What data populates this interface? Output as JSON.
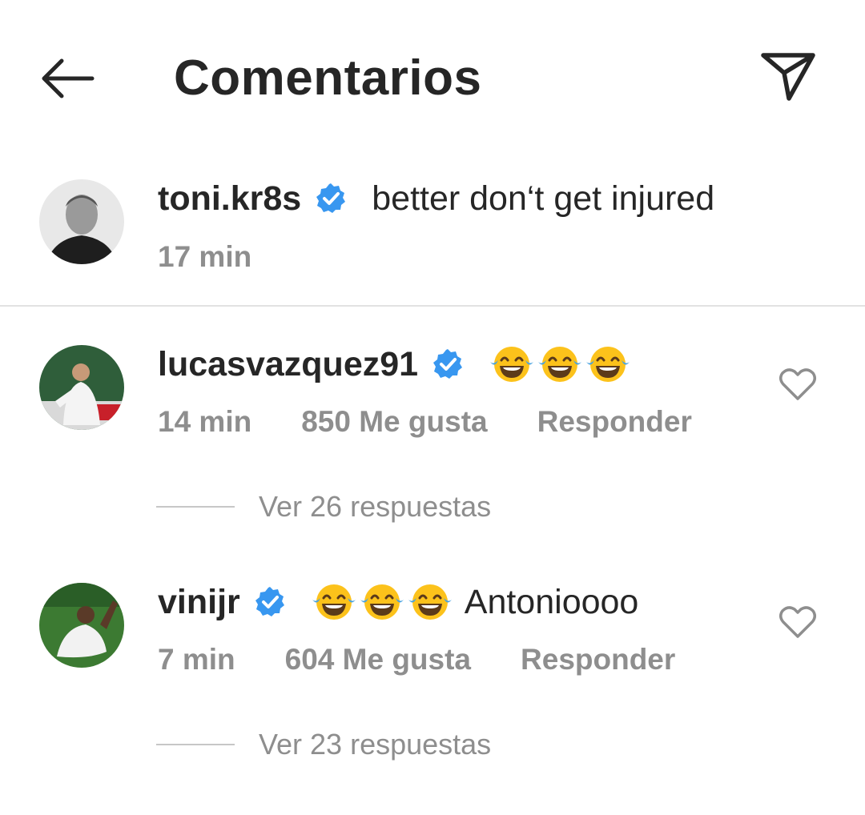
{
  "header": {
    "title": "Comentarios",
    "back_icon": "back-arrow-icon",
    "share_icon": "paper-plane-icon"
  },
  "caption": {
    "username": "toni.kr8s",
    "verified": true,
    "text": "better don‘t get injured",
    "time": "17 min"
  },
  "comments": [
    {
      "username": "lucasvazquez91",
      "verified": true,
      "emoji": "face-with-tears-of-joy x3",
      "text": "",
      "time": "14 min",
      "likes": "850 Me gusta",
      "reply_label": "Responder",
      "view_replies": "Ver 26 respuestas"
    },
    {
      "username": "vinijr",
      "verified": true,
      "emoji": "face-with-tears-of-joy x3",
      "text": "Antonioooo",
      "time": "7 min",
      "likes": "604 Me gusta",
      "reply_label": "Responder",
      "view_replies": "Ver 23 respuestas"
    }
  ],
  "colors": {
    "text_primary": "#262626",
    "text_secondary": "#8e8e8e",
    "verified_blue": "#3897f0",
    "divider": "#e2e2e2"
  }
}
